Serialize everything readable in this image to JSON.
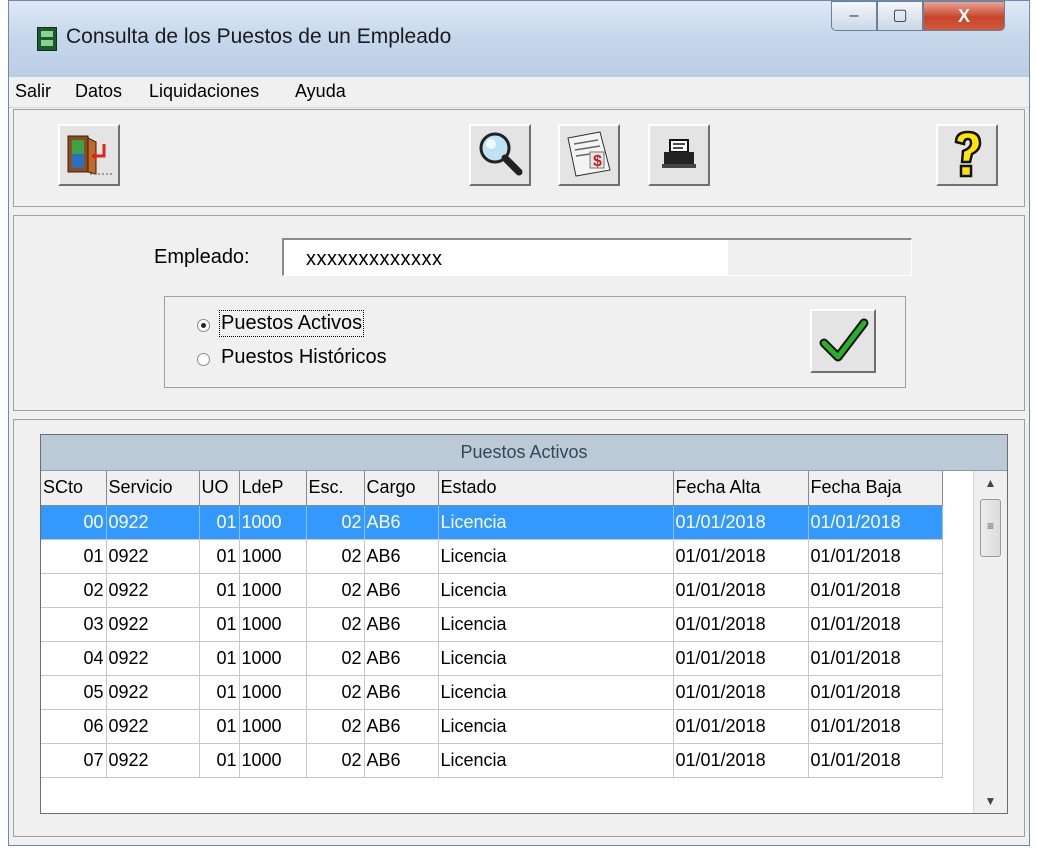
{
  "window": {
    "title": "Consulta de los Puestos de un Empleado",
    "controls": {
      "minimize": "–",
      "maximize": "▢",
      "close": "X"
    }
  },
  "menu": [
    "Salir",
    "Datos",
    "Liquidaciones",
    "Ayuda"
  ],
  "toolbar": {
    "exit_icon": "exit-door-icon",
    "search_icon": "magnifier-icon",
    "payslip_icon": "payroll-document-icon",
    "print_icon": "printer-icon",
    "help_icon": "help-question-icon"
  },
  "employee": {
    "label": "Empleado:",
    "value": "xxxxxxxxxxxxx"
  },
  "filter": {
    "options": [
      "Puestos Activos",
      "Puestos Históricos"
    ],
    "selected": 0,
    "confirm_icon": "checkmark-icon"
  },
  "grid": {
    "caption": "Puestos Activos",
    "columns": [
      "SCto",
      "Servicio",
      "UO",
      "LdeP",
      "Esc.",
      "Cargo",
      "Estado",
      "Fecha  Alta",
      "Fecha Baja"
    ],
    "selected_row": 0,
    "rows": [
      [
        "00",
        "0922",
        "01",
        "1000",
        "02",
        "AB6",
        "Licencia",
        "01/01/2018",
        "01/01/2018"
      ],
      [
        "01",
        "0922",
        "01",
        "1000",
        "02",
        "AB6",
        "Licencia",
        "01/01/2018",
        "01/01/2018"
      ],
      [
        "02",
        "0922",
        "01",
        "1000",
        "02",
        "AB6",
        "Licencia",
        "01/01/2018",
        "01/01/2018"
      ],
      [
        "03",
        "0922",
        "01",
        "1000",
        "02",
        "AB6",
        "Licencia",
        "01/01/2018",
        "01/01/2018"
      ],
      [
        "04",
        "0922",
        "01",
        "1000",
        "02",
        "AB6",
        "Licencia",
        "01/01/2018",
        "01/01/2018"
      ],
      [
        "05",
        "0922",
        "01",
        "1000",
        "02",
        "AB6",
        "Licencia",
        "01/01/2018",
        "01/01/2018"
      ],
      [
        "06",
        "0922",
        "01",
        "1000",
        "02",
        "AB6",
        "Licencia",
        "01/01/2018",
        "01/01/2018"
      ],
      [
        "07",
        "0922",
        "01",
        "1000",
        "02",
        "AB6",
        "Licencia",
        "01/01/2018",
        "01/01/2018"
      ]
    ]
  },
  "colors": {
    "selection": "#3399ff",
    "caption_bg": "#bcc9d7",
    "close_button": "#c7442b"
  }
}
